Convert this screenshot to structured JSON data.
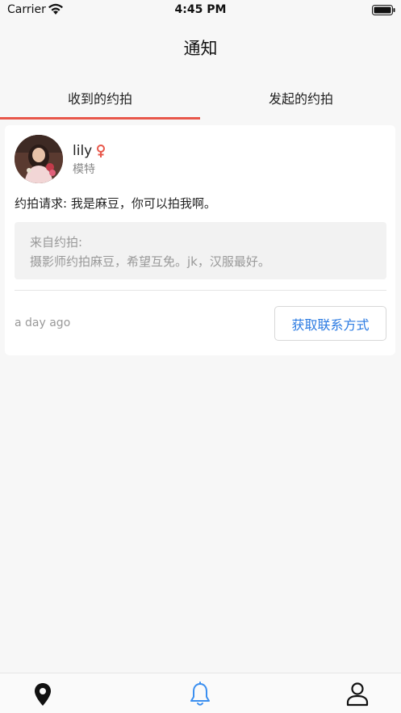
{
  "status_bar": {
    "carrier": "Carrier",
    "time": "4:45 PM"
  },
  "nav": {
    "title": "通知"
  },
  "tabs": [
    {
      "label": "收到的约拍",
      "active": true
    },
    {
      "label": "发起的约拍",
      "active": false
    }
  ],
  "notification": {
    "name": "lily",
    "gender_icon": "female-icon",
    "role": "模特",
    "request": "约拍请求: 我是麻豆，你可以拍我啊。",
    "origin_label": "来自约拍:",
    "origin_text": "摄影师约拍麻豆，希望互免。jk，汉服最好。",
    "time_ago": "a day ago",
    "contact_button": "获取联系方式"
  },
  "tab_bar": [
    {
      "icon": "location-pin-icon",
      "active": false
    },
    {
      "icon": "bell-icon",
      "active": true
    },
    {
      "icon": "person-icon",
      "active": false
    }
  ],
  "colors": {
    "accent_red": "#e8574a",
    "accent_blue": "#2a7ae2",
    "active_tab_icon": "#3b8ff0"
  }
}
